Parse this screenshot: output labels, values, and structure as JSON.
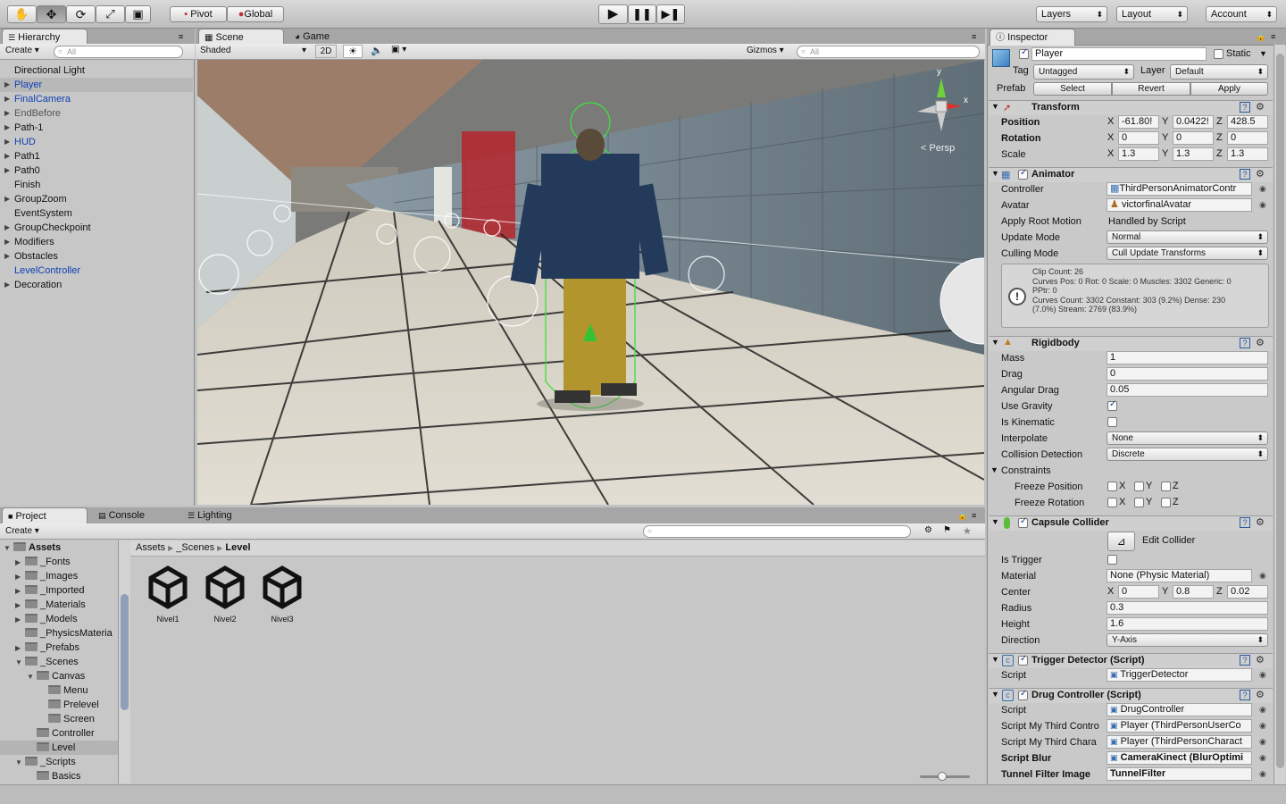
{
  "toolbar": {
    "pivot": "Pivot",
    "global": "Global",
    "layers": "Layers",
    "layout": "Layout",
    "account": "Account"
  },
  "hierarchy": {
    "tab": "Hierarchy",
    "create": "Create",
    "search_placeholder": "All",
    "items": [
      {
        "label": "Directional Light",
        "style": "normal",
        "arrow": false
      },
      {
        "label": "Player",
        "style": "blue-selected",
        "arrow": true
      },
      {
        "label": "FinalCamera",
        "style": "blue",
        "arrow": true
      },
      {
        "label": "EndBefore",
        "style": "grey",
        "arrow": true
      },
      {
        "label": "Path-1",
        "style": "normal",
        "arrow": true
      },
      {
        "label": "HUD",
        "style": "blue",
        "arrow": true
      },
      {
        "label": "Path1",
        "style": "normal",
        "arrow": true
      },
      {
        "label": "Path0",
        "style": "normal",
        "arrow": true
      },
      {
        "label": "Finish",
        "style": "normal",
        "arrow": false
      },
      {
        "label": "GroupZoom",
        "style": "normal",
        "arrow": true
      },
      {
        "label": "EventSystem",
        "style": "normal",
        "arrow": false
      },
      {
        "label": "GroupCheckpoint",
        "style": "normal",
        "arrow": true
      },
      {
        "label": "Modifiers",
        "style": "normal",
        "arrow": true
      },
      {
        "label": "Obstacles",
        "style": "normal",
        "arrow": true
      },
      {
        "label": "LevelController",
        "style": "blue",
        "arrow": false
      },
      {
        "label": "Decoration",
        "style": "normal",
        "arrow": true
      }
    ]
  },
  "scene": {
    "tab_scene": "Scene",
    "tab_game": "Game",
    "shading": "Shaded",
    "mode_2d": "2D",
    "gizmos": "Gizmos",
    "search_placeholder": "All",
    "gizmo_x": "x",
    "gizmo_y": "y",
    "persp": "Persp"
  },
  "project": {
    "tab_project": "Project",
    "tab_console": "Console",
    "tab_lighting": "Lighting",
    "create": "Create",
    "breadcrumb": [
      "Assets",
      "_Scenes",
      "Level"
    ],
    "tree": [
      {
        "label": "Assets",
        "depth": 0,
        "arrow": "open",
        "bold": true
      },
      {
        "label": "_Fonts",
        "depth": 1,
        "arrow": "closed"
      },
      {
        "label": "_Images",
        "depth": 1,
        "arrow": "closed"
      },
      {
        "label": "_Imported",
        "depth": 1,
        "arrow": "closed"
      },
      {
        "label": "_Materials",
        "depth": 1,
        "arrow": "closed"
      },
      {
        "label": "_Models",
        "depth": 1,
        "arrow": "closed"
      },
      {
        "label": "_PhysicsMateria",
        "depth": 1,
        "arrow": "none"
      },
      {
        "label": "_Prefabs",
        "depth": 1,
        "arrow": "closed"
      },
      {
        "label": "_Scenes",
        "depth": 1,
        "arrow": "open"
      },
      {
        "label": "Canvas",
        "depth": 2,
        "arrow": "open"
      },
      {
        "label": "Menu",
        "depth": 3,
        "arrow": "none"
      },
      {
        "label": "Prelevel",
        "depth": 3,
        "arrow": "none"
      },
      {
        "label": "Screen",
        "depth": 3,
        "arrow": "none"
      },
      {
        "label": "Controller",
        "depth": 2,
        "arrow": "none"
      },
      {
        "label": "Level",
        "depth": 2,
        "arrow": "none",
        "selected": true
      },
      {
        "label": "_Scripts",
        "depth": 1,
        "arrow": "open"
      },
      {
        "label": "Basics",
        "depth": 2,
        "arrow": "none"
      }
    ],
    "assets": [
      "Nivel1",
      "Nivel2",
      "Nivel3"
    ]
  },
  "inspector": {
    "tab": "Inspector",
    "object_name": "Player",
    "static_label": "Static",
    "tag_label": "Tag",
    "tag_value": "Untagged",
    "layer_label": "Layer",
    "layer_value": "Default",
    "prefab_label": "Prefab",
    "prefab_select": "Select",
    "prefab_revert": "Revert",
    "prefab_apply": "Apply",
    "transform": {
      "title": "Transform",
      "position_label": "Position",
      "rotation_label": "Rotation",
      "scale_label": "Scale",
      "position": [
        "-61.80!",
        "0.0422!",
        "428.5"
      ],
      "rotation": [
        "0",
        "0",
        "0"
      ],
      "scale": [
        "1.3",
        "1.3",
        "1.3"
      ]
    },
    "animator": {
      "title": "Animator",
      "controller_label": "Controller",
      "controller_value": "ThirdPersonAnimatorContr",
      "avatar_label": "Avatar",
      "avatar_value": "victorfinalAvatar",
      "apply_root_motion_label": "Apply Root Motion",
      "apply_root_motion_value": "Handled by Script",
      "update_mode_label": "Update Mode",
      "update_mode_value": "Normal",
      "culling_mode_label": "Culling Mode",
      "culling_mode_value": "Cull Update Transforms",
      "info_line1": "Clip Count: 26",
      "info_line2": "Curves Pos: 0 Rot: 0 Scale: 0 Muscles: 3302 Generic: 0",
      "info_line3": "PPtr: 0",
      "info_line4": "Curves Count: 3302 Constant: 303 (9.2%) Dense: 230",
      "info_line5": "(7.0%) Stream: 2769 (83.9%)"
    },
    "rigidbody": {
      "title": "Rigidbody",
      "mass_label": "Mass",
      "mass": "1",
      "drag_label": "Drag",
      "drag": "0",
      "angular_drag_label": "Angular Drag",
      "angular_drag": "0.05",
      "use_gravity_label": "Use Gravity",
      "is_kinematic_label": "Is Kinematic",
      "interpolate_label": "Interpolate",
      "interpolate": "None",
      "collision_detection_label": "Collision Detection",
      "collision_detection": "Discrete",
      "constraints_label": "Constraints",
      "freeze_position_label": "Freeze Position",
      "freeze_rotation_label": "Freeze Rotation"
    },
    "capsule": {
      "title": "Capsule Collider",
      "edit_collider": "Edit Collider",
      "is_trigger_label": "Is Trigger",
      "material_label": "Material",
      "material": "None (Physic Material)",
      "center_label": "Center",
      "center": [
        "0",
        "0.8",
        "0.02"
      ],
      "radius_label": "Radius",
      "radius": "0.3",
      "height_label": "Height",
      "height": "1.6",
      "direction_label": "Direction",
      "direction": "Y-Axis"
    },
    "trigger_detector": {
      "title": "Trigger Detector (Script)",
      "script_label": "Script",
      "script": "TriggerDetector"
    },
    "drug_controller": {
      "title": "Drug Controller (Script)",
      "script_label": "Script",
      "script": "DrugController",
      "f1_label": "Script My Third Contro",
      "f1": "Player (ThirdPersonUserCo",
      "f2_label": "Script My Third Chara",
      "f2": "Player (ThirdPersonCharact",
      "f3_label": "Script Blur",
      "f3": "CameraKinect (BlurOptimi",
      "f4_label": "Tunnel Filter Image",
      "f4": "TunnelFilter"
    },
    "axis_x": "X",
    "axis_y": "Y",
    "axis_z": "Z"
  }
}
